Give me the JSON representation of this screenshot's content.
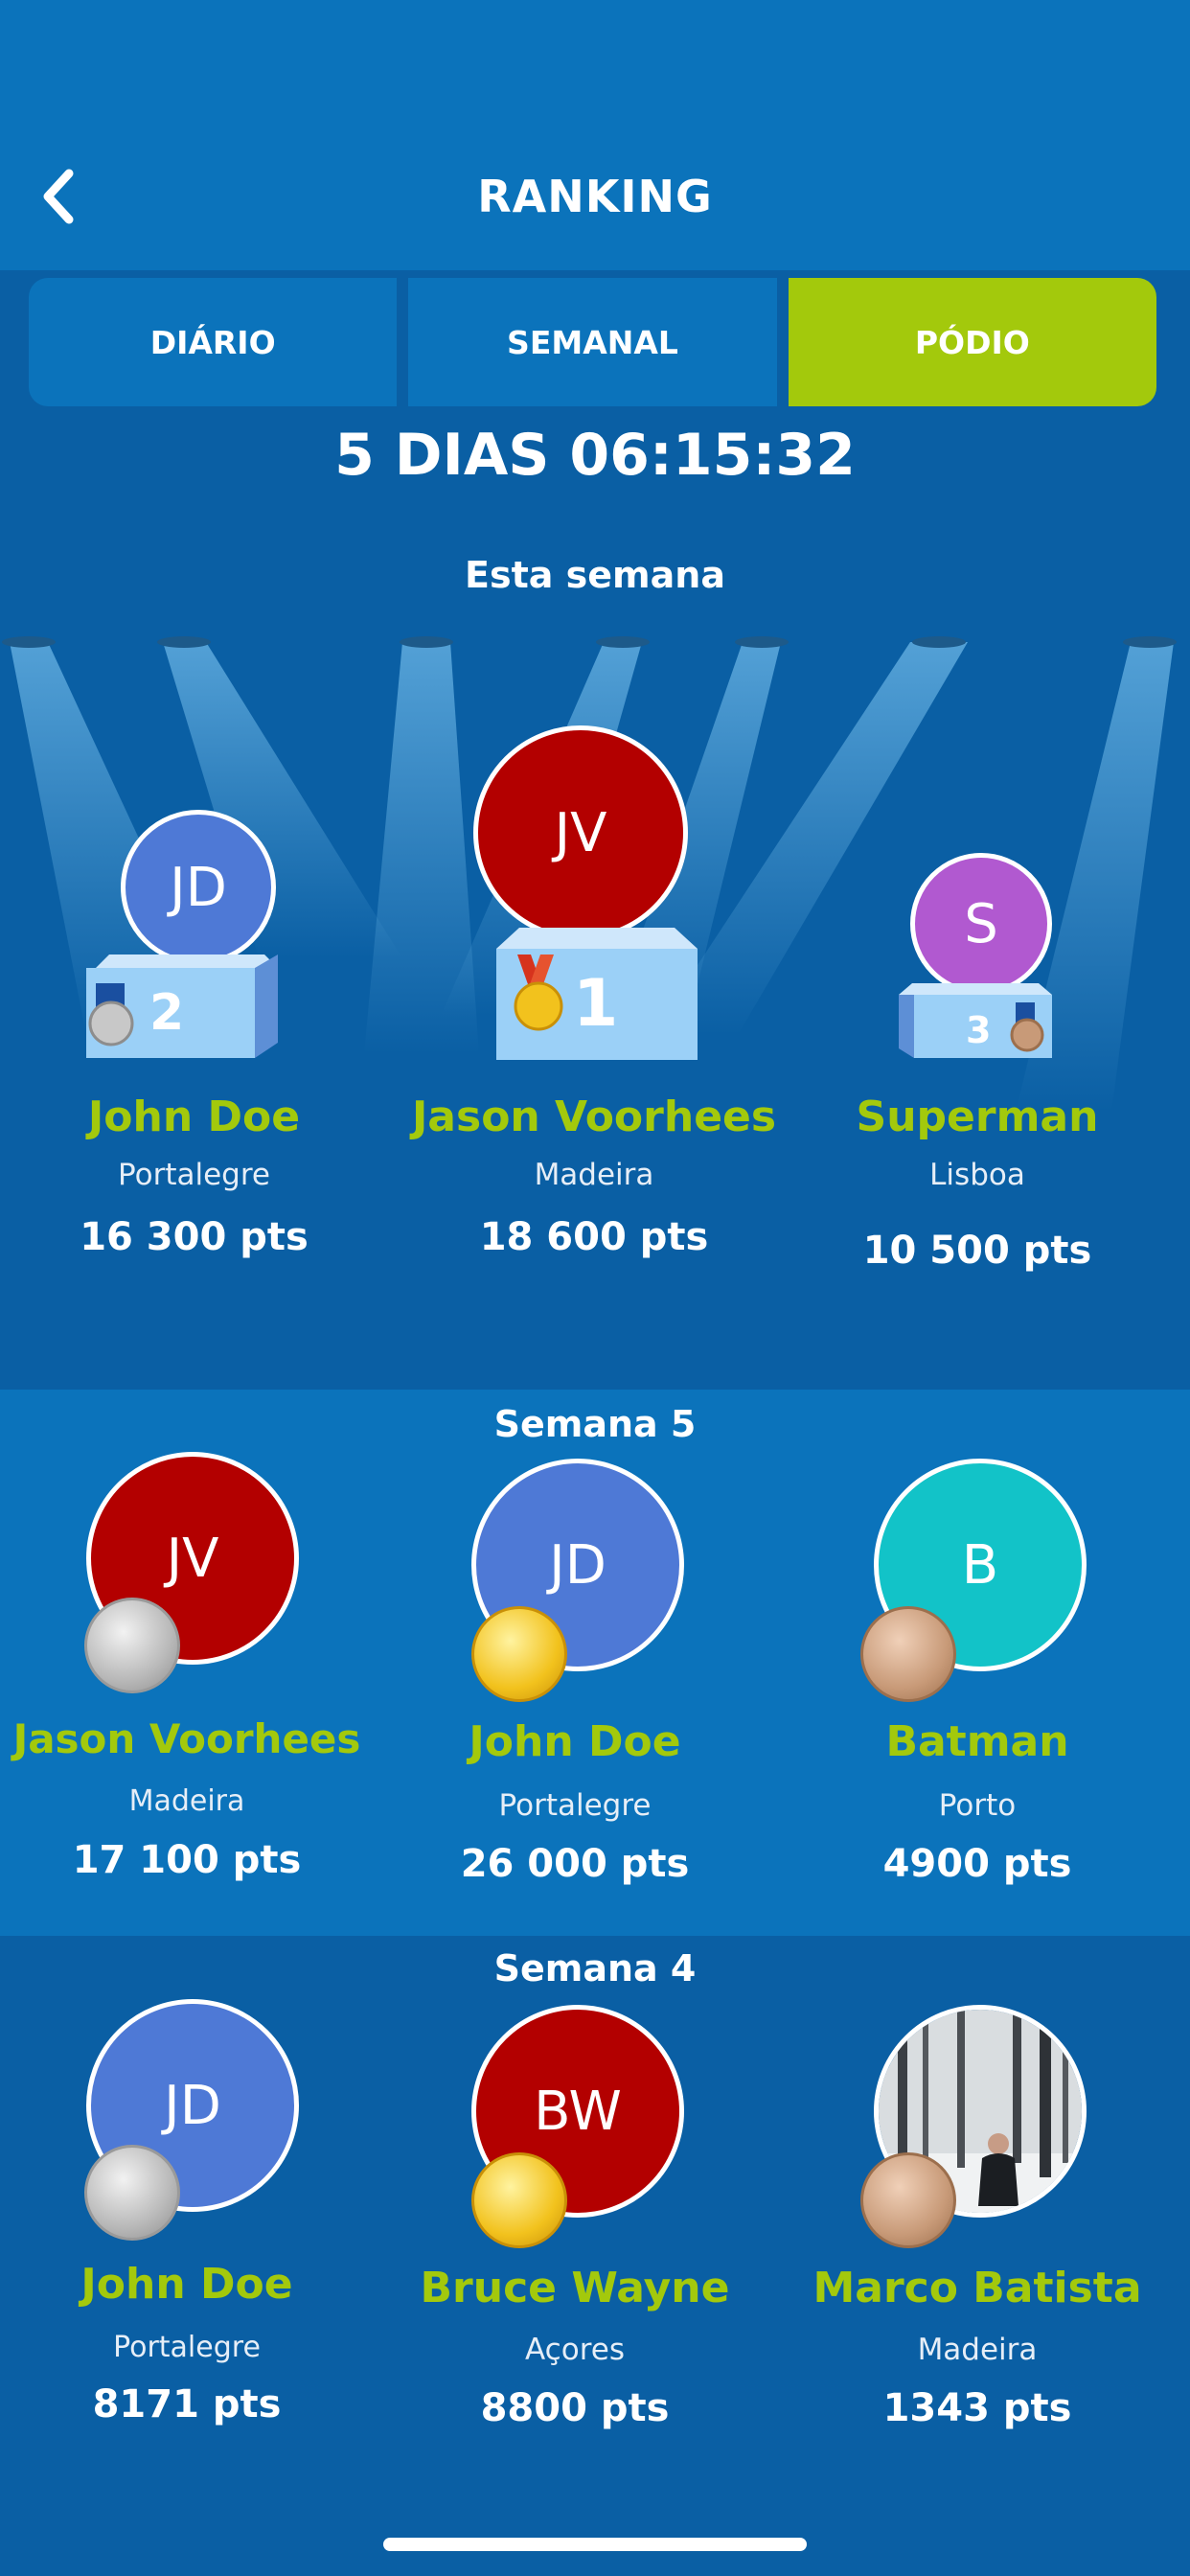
{
  "header": {
    "title": "RANKING",
    "back_icon": "chevron-left-icon"
  },
  "tabs": [
    {
      "label": "DIÁRIO",
      "active": false
    },
    {
      "label": "SEMANAL",
      "active": false
    },
    {
      "label": "PÓDIO",
      "active": true
    }
  ],
  "countdown": "5 DIAS 06:15:32",
  "this_week": {
    "label": "Esta semana",
    "podium": [
      {
        "place": "2",
        "initials": "JD",
        "name": "John Doe",
        "city": "Portalegre",
        "points": "16 300 pts",
        "avatar_color": "#4e79d6",
        "medal": "silver"
      },
      {
        "place": "1",
        "initials": "JV",
        "name": "Jason Voorhees",
        "city": "Madeira",
        "points": "18 600 pts",
        "avatar_color": "#b30000",
        "medal": "gold"
      },
      {
        "place": "3",
        "initials": "S",
        "name": "Superman",
        "city": "Lisboa",
        "points": "10 500 pts",
        "avatar_color": "#b159d0",
        "medal": "bronze"
      }
    ]
  },
  "week5": {
    "label": "Semana 5",
    "entries": [
      {
        "initials": "JV",
        "name": "Jason Voorhees",
        "city": "Madeira",
        "points": "17 100 pts",
        "avatar_color": "#b30000",
        "medal": "silver"
      },
      {
        "initials": "JD",
        "name": "John Doe",
        "city": "Portalegre",
        "points": "26 000 pts",
        "avatar_color": "#4e79d6",
        "medal": "gold"
      },
      {
        "initials": "B",
        "name": "Batman",
        "city": "Porto",
        "points": "4900 pts",
        "avatar_color": "#12c3c8",
        "medal": "bronze"
      }
    ]
  },
  "week4": {
    "label": "Semana 4",
    "entries": [
      {
        "initials": "JD",
        "name": "John Doe",
        "city": "Portalegre",
        "points": "8171 pts",
        "avatar_color": "#4e79d6",
        "medal": "silver"
      },
      {
        "initials": "BW",
        "name": "Bruce Wayne",
        "city": "Açores",
        "points": "8800 pts",
        "avatar_color": "#b30000",
        "medal": "gold"
      },
      {
        "initials": "",
        "name": "Marco Batista",
        "city": "Madeira",
        "points": "1343 pts",
        "avatar_color": "",
        "medal": "bronze"
      }
    ]
  },
  "colors": {
    "accent_green": "#a3c90c",
    "header_blue": "#0b73bb",
    "page_blue": "#0a5fa4"
  }
}
